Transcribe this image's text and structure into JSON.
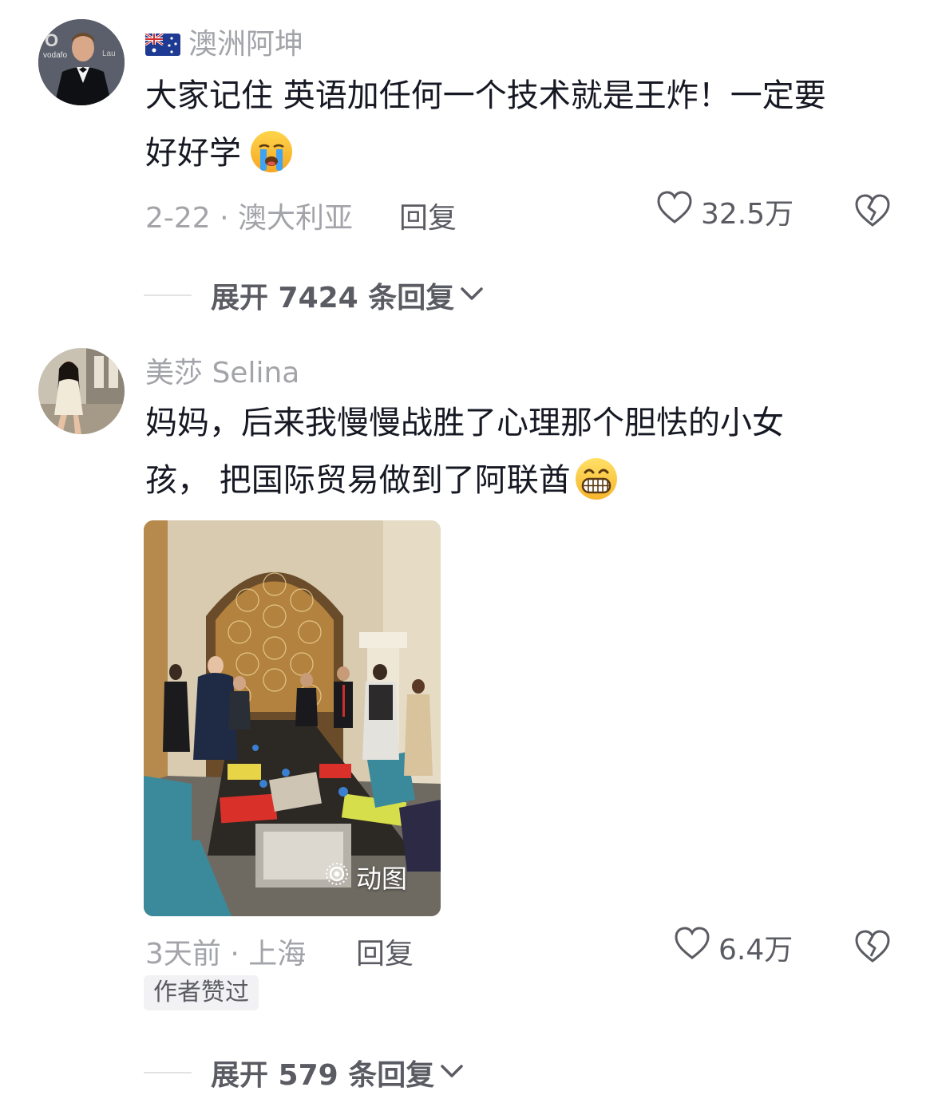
{
  "colors": {
    "text_primary": "#161823",
    "text_secondary": "#a3a4a9",
    "text_action": "#5b5c63",
    "divider": "#e3e3e6",
    "tag_bg": "#f2f2f4"
  },
  "comments": [
    {
      "author": "澳洲阿坤",
      "author_badge_icon": "australia-flag-icon",
      "avatar_icon": "man-in-tuxedo-avatar",
      "text_lines": [
        "大家记住 英语加任何一个技术就是王炸！一定要",
        "好好学"
      ],
      "emoji_icon": "loudly-crying-face-emoji",
      "meta": "2-22 · 澳大利亚",
      "reply_label": "回复",
      "likes": "32.5万",
      "expand_label": "展开 7424 条回复"
    },
    {
      "author": "美莎 Selina",
      "avatar_icon": "woman-in-dress-avatar",
      "text_lines": [
        "妈妈，后来我慢慢战胜了心理那个胆怯的小女",
        "孩， 把国际贸易做到了阿联酋"
      ],
      "emoji_icon": "grinning-face-emoji",
      "image": {
        "description_icon": "meeting-room-photo",
        "badge_label": "动图"
      },
      "meta": "3天前 · 上海",
      "reply_label": "回复",
      "likes": "6.4万",
      "author_liked_tag": "作者赞过",
      "expand_label": "展开 579 条回复"
    }
  ]
}
